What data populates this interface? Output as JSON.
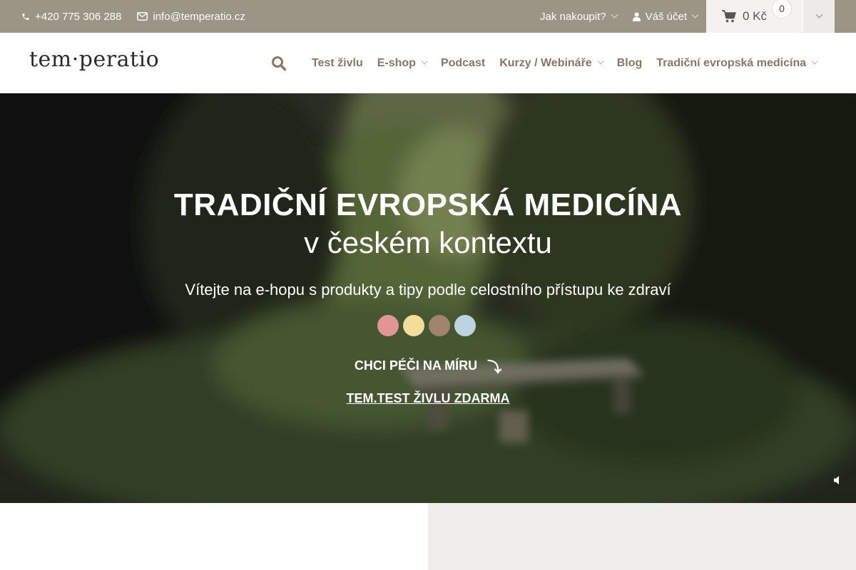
{
  "topbar": {
    "phone": "+420 775 306 288",
    "email": "info@temperatio.cz",
    "how_to_buy": "Jak nakoupit?",
    "account": "Váš účet",
    "cart_total": "0 Kč",
    "cart_count": "0",
    "icons": {
      "phone": "phone-icon",
      "email": "envelope-icon",
      "user": "user-icon",
      "cart": "cart-icon"
    }
  },
  "header": {
    "logo": "tem·peratio",
    "nav": [
      {
        "label": "Test živlu",
        "dropdown": false
      },
      {
        "label": "E-shop",
        "dropdown": true
      },
      {
        "label": "Podcast",
        "dropdown": false
      },
      {
        "label": "Kurzy / Webináře",
        "dropdown": true
      },
      {
        "label": "Blog",
        "dropdown": false
      },
      {
        "label": "Tradiční evropská medicína",
        "dropdown": true
      }
    ]
  },
  "hero": {
    "title": "TRADIČNÍ EVROPSKÁ MEDICÍNA",
    "subtitle": "v českém kontextu",
    "welcome": "Vítejte na e-hopu s produkty a tipy podle celostního přístupu ke zdraví",
    "element_dots": [
      "#e19594",
      "#f2de9b",
      "#a2836e",
      "#bed3e0"
    ],
    "cta": "CHCI PÉČI NA MÍRU",
    "cta_arrow": "⤵",
    "test_link": "TEM.TEST ŽIVLU ZDARMA"
  },
  "colors": {
    "topbar_bg": "#9a9585",
    "nav_text": "#8a7663",
    "cart_bg": "#f3f2ef",
    "bottom_right_bg": "#efeeeb"
  }
}
